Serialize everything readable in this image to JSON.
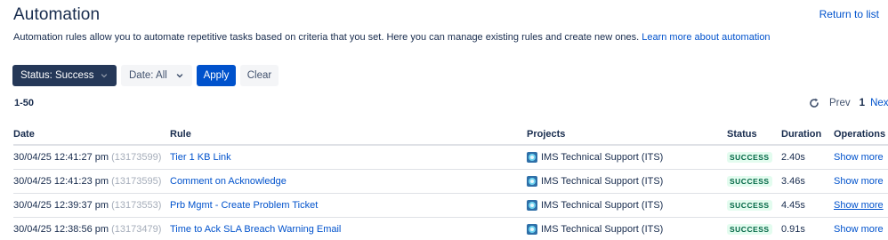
{
  "page": {
    "title": "Automation",
    "return_link": "Return to list",
    "description": "Automation rules allow you to automate repetitive tasks based on criteria that you set. Here you can manage existing rules and create new ones. ",
    "learn_more": "Learn more about automation"
  },
  "filters": {
    "status_label": "Status: Success",
    "date_label": "Date: All",
    "apply_label": "Apply",
    "clear_label": "Clear"
  },
  "pagination": {
    "range": "1-50",
    "prev": "Prev",
    "current": "1",
    "next": "Next"
  },
  "table": {
    "headers": {
      "date": "Date",
      "rule": "Rule",
      "projects": "Projects",
      "status": "Status",
      "duration": "Duration",
      "operations": "Operations"
    },
    "rows": [
      {
        "date": "30/04/25 12:41:27 pm",
        "id": "(13173599)",
        "rule": "Tier 1 KB Link",
        "project": "IMS Technical Support (ITS)",
        "status": "SUCCESS",
        "duration": "2.40s",
        "operation": "Show more"
      },
      {
        "date": "30/04/25 12:41:23 pm",
        "id": "(13173595)",
        "rule": "Comment on Acknowledge",
        "project": "IMS Technical Support (ITS)",
        "status": "SUCCESS",
        "duration": "3.46s",
        "operation": "Show more"
      },
      {
        "date": "30/04/25 12:39:37 pm",
        "id": "(13173553)",
        "rule": "Prb Mgmt - Create Problem Ticket",
        "project": "IMS Technical Support (ITS)",
        "status": "SUCCESS",
        "duration": "4.45s",
        "operation": "Show more"
      },
      {
        "date": "30/04/25 12:38:56 pm",
        "id": "(13173479)",
        "rule": "Time to Ack SLA Breach Warning Email",
        "project": "IMS Technical Support (ITS)",
        "status": "SUCCESS",
        "duration": "0.91s",
        "operation": "Show more"
      }
    ]
  },
  "colors": {
    "link": "#0052cc",
    "status_button": "#253858",
    "apply_button": "#0052cc",
    "success_bg": "#e3fcef",
    "success_text": "#006644"
  },
  "icons": {
    "chevron": "chevron-down-icon",
    "refresh": "refresh-icon",
    "project": "project-avatar-icon"
  }
}
